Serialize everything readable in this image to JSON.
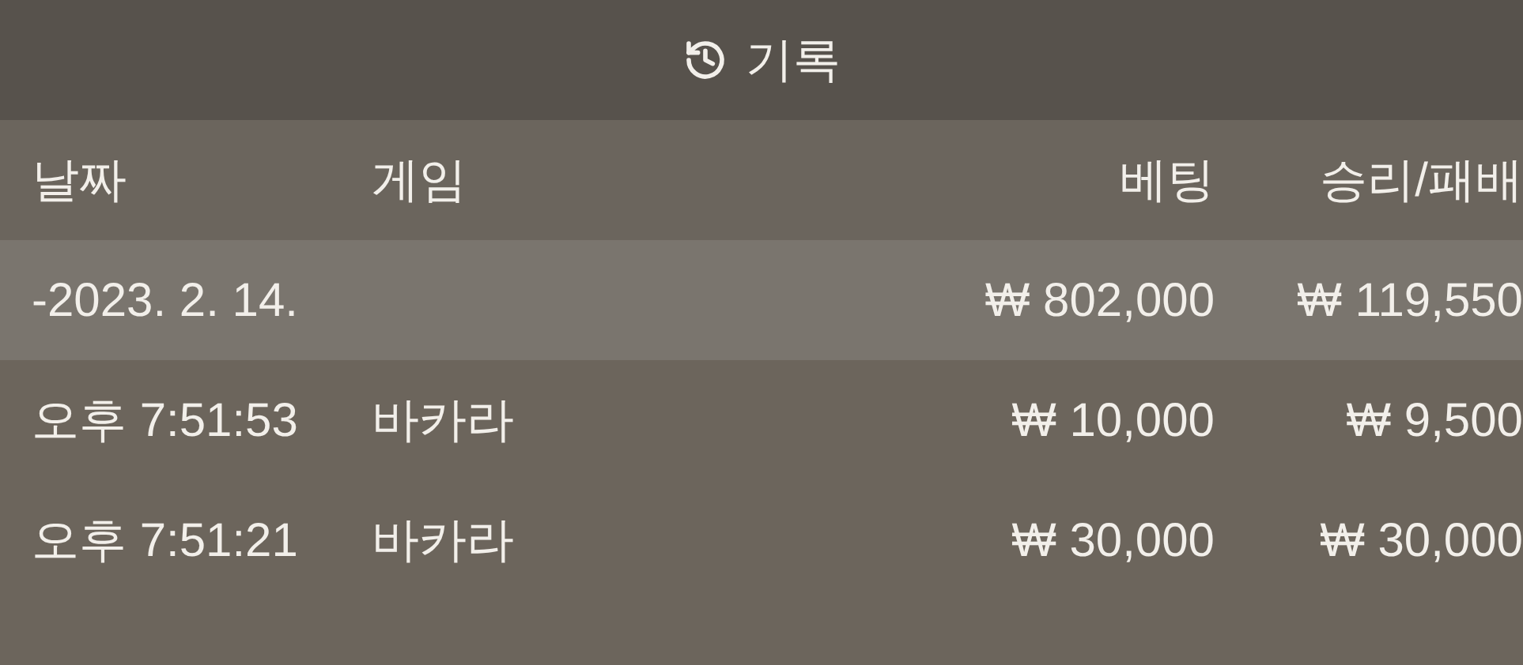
{
  "title": "기록",
  "columns": [
    "날짜",
    "게임",
    "베팅",
    "승리/패배"
  ],
  "summary": {
    "date": "-2023. 2. 14.",
    "bet": "₩ 802,000",
    "result": "₩ 119,550"
  },
  "rows": [
    {
      "time": "오후 7:51:53",
      "game": "바카라",
      "bet": "₩ 10,000",
      "result": "₩ 9,500"
    },
    {
      "time": "오후 7:51:21",
      "game": "바카라",
      "bet": "₩ 30,000",
      "result": "₩ 30,000"
    }
  ]
}
